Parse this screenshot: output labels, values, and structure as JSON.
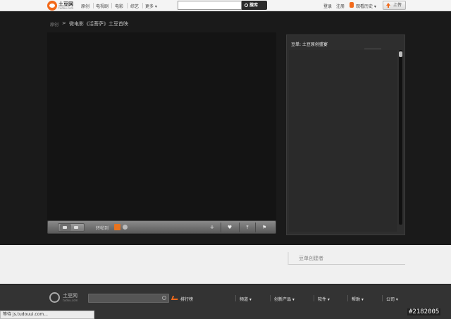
{
  "header": {
    "logo_name": "土豆网",
    "logo_sub": "tudou.com",
    "nav": [
      "原创",
      "电视剧",
      "电影",
      "综艺",
      "更多"
    ],
    "search_placeholder": "",
    "search_button": "搜库",
    "login": "登录",
    "register": "注册",
    "history": "观看历史",
    "upload": "上传"
  },
  "breadcrumb": {
    "home": "原创",
    "separator": ">",
    "path": "微电影《活菩萨》土豆首映"
  },
  "controls": {
    "share_label": "转帖到",
    "add_icon": "+",
    "fav_icon": "♥",
    "up_icon": "⤒",
    "flag_icon": "⚑"
  },
  "playlist": {
    "title": "豆单: 土豆原创盛宴"
  },
  "creators": {
    "label": "豆单创建者"
  },
  "footer": {
    "logo_name": "土豆网",
    "logo_sub": "tudou.com",
    "rank": "排行榜",
    "links": [
      "频道",
      "创新产品",
      "软件",
      "帮助",
      "公司"
    ]
  },
  "status": {
    "text": "等待 js.tudouui.com..."
  },
  "watermark": "#2182005",
  "colors": {
    "accent": "#f26a1b",
    "page_bg": "#1a1a1a"
  }
}
